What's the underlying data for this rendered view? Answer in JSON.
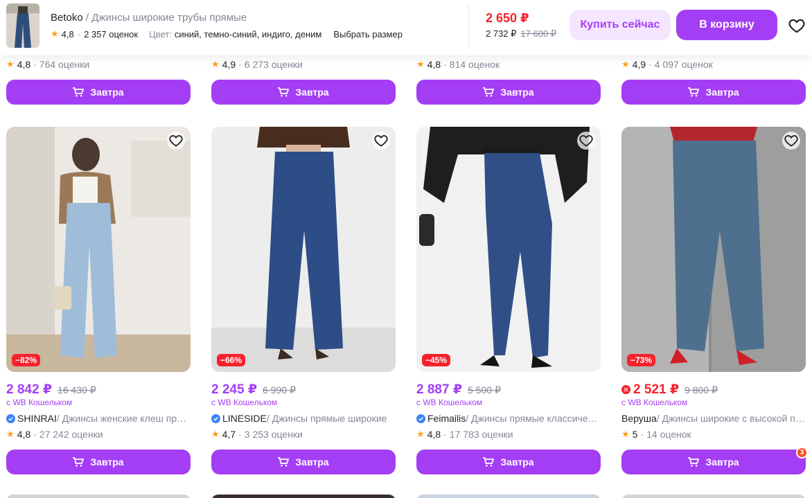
{
  "sticky": {
    "brand": "Betoko",
    "separator": " / ",
    "product_name": "Джинсы широкие трубы прямые",
    "rating": "4,8",
    "reviews": "2 357 оценок",
    "color_label": "Цвет:",
    "color_value": "синий, темно-синий, индиго, деним",
    "size_link": "Выбрать размер",
    "price": "2 650 ₽",
    "wallet_price": "2 732 ₽",
    "old_price": "17 600 ₽",
    "buy_now_label": "Купить сейчас",
    "add_to_cart_label": "В корзину",
    "icons": {
      "favorite": "heart-icon",
      "rating": "star-icon"
    }
  },
  "top_row": [
    {
      "rating": "4,8",
      "reviews": "764 оценки",
      "button": "Завтра"
    },
    {
      "rating": "4,9",
      "reviews": "6 273 оценки",
      "button": "Завтра"
    },
    {
      "rating": "4,8",
      "reviews": "814 оценок",
      "button": "Завтра"
    },
    {
      "rating": "4,9",
      "reviews": "4 097 оценок",
      "button": "Завтра"
    }
  ],
  "cards": [
    {
      "discount": "−82%",
      "price": "2 842 ₽",
      "old_price": "16 430 ₽",
      "wallet": "с WB Кошельком",
      "brand": "SHINRAI",
      "name": " / Джинсы женские клеш прямые",
      "rating": "4,8",
      "reviews": "27 242 оценки",
      "button": "Завтра"
    },
    {
      "discount": "−66%",
      "price": "2 245 ₽",
      "old_price": "6 990 ₽",
      "wallet": "с WB Кошельком",
      "brand": "LINESIDE",
      "name": " / Джинсы прямые широкие",
      "rating": "4,7",
      "reviews": "3 253 оценки",
      "button": "Завтра"
    },
    {
      "discount": "−45%",
      "price": "2 887 ₽",
      "old_price": "5 500 ₽",
      "wallet": "с WB Кошельком",
      "brand": "Feimailis",
      "name": " / Джинсы прямые классические",
      "rating": "4,8",
      "reviews": "17 783 оценки",
      "button": "Завтра"
    },
    {
      "discount": "−73%",
      "price": "2 521 ₽",
      "old_price": "9 800 ₽",
      "wallet": "с WB Кошельком",
      "brand": "Веруша",
      "name": " / Джинсы широкие с высокой посадкой",
      "rating": "5",
      "reviews": "14 оценок",
      "button": "Завтра",
      "cart_badge": "3"
    }
  ],
  "colors": {
    "accent": "#a43ef5",
    "accent_light": "#f5e6ff",
    "price_red": "#f5222d",
    "muted_text": "#868695",
    "star": "#ff9f1a",
    "verified_blue": "#3b82f6"
  }
}
